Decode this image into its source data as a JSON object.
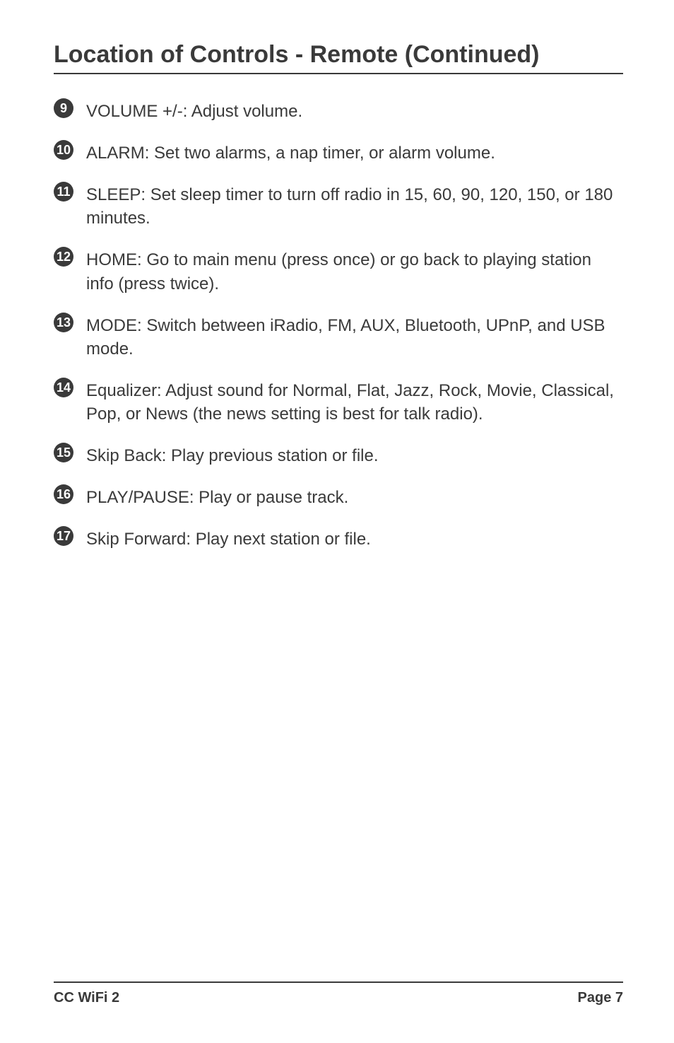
{
  "title": "Location of Controls - Remote (Continued)",
  "items": [
    {
      "num": "9",
      "text": "VOLUME +/-:  Adjust volume."
    },
    {
      "num": "10",
      "text": "ALARM:  Set two alarms, a nap timer, or alarm volume."
    },
    {
      "num": "11",
      "text": "SLEEP:  Set sleep timer to turn off radio in 15, 60, 90, 120, 150, or 180 minutes."
    },
    {
      "num": "12",
      "text": "HOME:  Go to main menu (press once) or go back to playing station info (press twice)."
    },
    {
      "num": "13",
      "text": "MODE:  Switch between iRadio, FM, AUX, Bluetooth, UPnP, and USB mode."
    },
    {
      "num": "14",
      "text": "Equalizer:  Adjust sound for Normal, Flat, Jazz, Rock, Movie, Classical, Pop, or News (the news setting is best for talk radio)."
    },
    {
      "num": "15",
      "text": "Skip Back:  Play previous station or file."
    },
    {
      "num": "16",
      "text": "PLAY/PAUSE:  Play or pause track."
    },
    {
      "num": "17",
      "text": "Skip Forward:  Play next station or file."
    }
  ],
  "footer": {
    "left": "CC WiFi 2",
    "right": "Page 7"
  }
}
